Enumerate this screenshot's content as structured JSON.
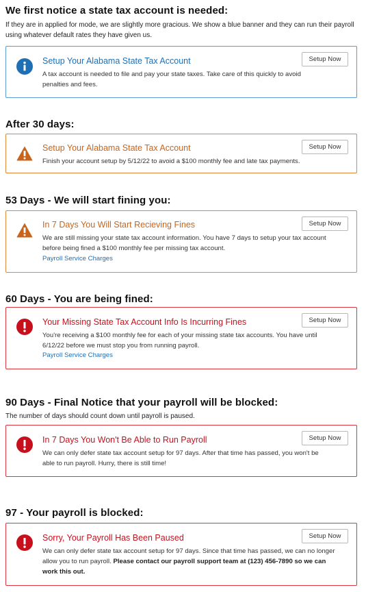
{
  "sections": [
    {
      "heading": "We first notice a state tax account is needed:",
      "subtext": "If they are in applied for mode, we are slightly more gracious. We show a blue banner and they can run their payroll using whatever default rates they have given us.",
      "banner": {
        "type": "info",
        "icon": "info-circle-icon",
        "title": "Setup Your Alabama State Tax Account",
        "body": "A tax account is needed to file and pay your state taxes. Take care of this quickly to avoid penalties and fees.",
        "button": "Setup Now"
      }
    },
    {
      "heading": "After 30 days:",
      "banner": {
        "type": "warn",
        "icon": "warning-triangle-icon",
        "title": "Setup Your Alabama State Tax Account",
        "body": "Finish your account setup by 5/12/22 to avoid a $100 monthly fee and late tax payments.",
        "button": "Setup Now"
      }
    },
    {
      "heading": "53 Days - We will start fining you:",
      "banner": {
        "type": "warn",
        "icon": "warning-triangle-icon",
        "title": "In 7 Days You Will Start Recieving Fines",
        "body": "We are still missing your state tax account information. You have 7 days to setup your tax account before being fined a $100 monthly fee per missing tax account.",
        "link": "Payroll Service Charges",
        "button": "Setup Now"
      }
    },
    {
      "heading": "60 Days - You are being fined:",
      "banner": {
        "type": "error",
        "icon": "error-circle-icon",
        "title": "Your Missing State Tax Account Info Is Incurring Fines",
        "body": "You're receiving a $100 monthly fee for each of your missing state tax accounts. You have until 6/12/22 before we must stop you from running payroll.",
        "link": "Payroll Service Charges",
        "button": "Setup Now"
      }
    },
    {
      "heading": "90 Days - Final Notice that your payroll will be blocked:",
      "subtext": "The number of days should count down until payroll is paused.",
      "banner": {
        "type": "error",
        "icon": "error-circle-icon",
        "title": "In 7 Days You Won't Be Able to Run Payroll",
        "body": "We can only defer state tax account setup for 97 days. After that time has passed, you won't be able to run payroll. Hurry, there is still time!",
        "button": "Setup Now"
      }
    },
    {
      "heading": "97 - Your payroll is blocked:",
      "banner": {
        "type": "error",
        "icon": "error-circle-icon",
        "title": "Sorry, Your Payroll Has Been Paused",
        "body": "We can only defer state tax account setup for 97 days. Since that time has passed, we can no longer allow you to run payroll.",
        "body_strong": "Please contact our payroll support team at (123) 456-7890 so we can work this out.",
        "button": "Setup Now"
      }
    }
  ],
  "colors": {
    "info": "#1f6fb5",
    "warn": "#c8641b",
    "error": "#c8101d",
    "info_border": "#5b9bd5",
    "warn_border": "#e0873a",
    "error_border": "#d9363e"
  }
}
